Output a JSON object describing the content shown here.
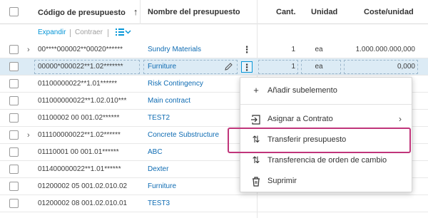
{
  "header": {
    "code_label": "Código de presupuesto",
    "sort_icon": "arrow-up-icon",
    "name_label": "Nombre del presupuesto",
    "qty_label": "Cant.",
    "unit_label": "Unidad",
    "cost_label": "Coste/unidad"
  },
  "toolbar": {
    "expand_label": "Expandir",
    "collapse_label": "Contraer",
    "list_options_icon": "list-options-icon",
    "chevron_icon": "chevron-down-icon"
  },
  "rows": [
    {
      "code": "00****000002**00020******",
      "name": "Sundry Materials",
      "qty": "1",
      "unit": "ea",
      "cost": "1.000.000.000,000",
      "expandable": true
    },
    {
      "code": "00000*000022**1.02*******",
      "name": "Furniture",
      "qty": "1",
      "unit": "ea",
      "cost": "0,000",
      "selected": true
    },
    {
      "code": "01100000022**1.01******",
      "name": "Risk Contingency"
    },
    {
      "code": "011000000022**1.02.010***",
      "name": "Main contract"
    },
    {
      "code": "01100002 00 001.02******",
      "name": "TEST2"
    },
    {
      "code": "011100000022**1.02******",
      "name": "Concrete Substructure",
      "expandable": true
    },
    {
      "code": "01110001 00 001.01******",
      "name": "ABC"
    },
    {
      "code": "011400000022**1.01******",
      "name": "Dexter"
    },
    {
      "code": "01200002 05 001.02.010.02",
      "name": "Furniture"
    },
    {
      "code": "01200002 08 001.02.010.01",
      "name": "TEST3"
    }
  ],
  "context_menu": {
    "items": [
      {
        "icon": "plus-icon",
        "label": "Añadir subelemento"
      },
      {
        "icon": "assign-icon",
        "label": "Asignar a Contrato",
        "submenu": true
      },
      {
        "icon": "transfer-icon",
        "label": "Transferir presupuesto",
        "highlighted": true
      },
      {
        "icon": "transfer-icon",
        "label": "Transferencia de orden de cambio"
      },
      {
        "icon": "trash-icon",
        "label": "Suprimir"
      }
    ]
  },
  "colors": {
    "accent": "#0696d7",
    "link": "#0f6cb3",
    "selected_row": "#dcebf5",
    "highlight_border": "#c0357a"
  }
}
